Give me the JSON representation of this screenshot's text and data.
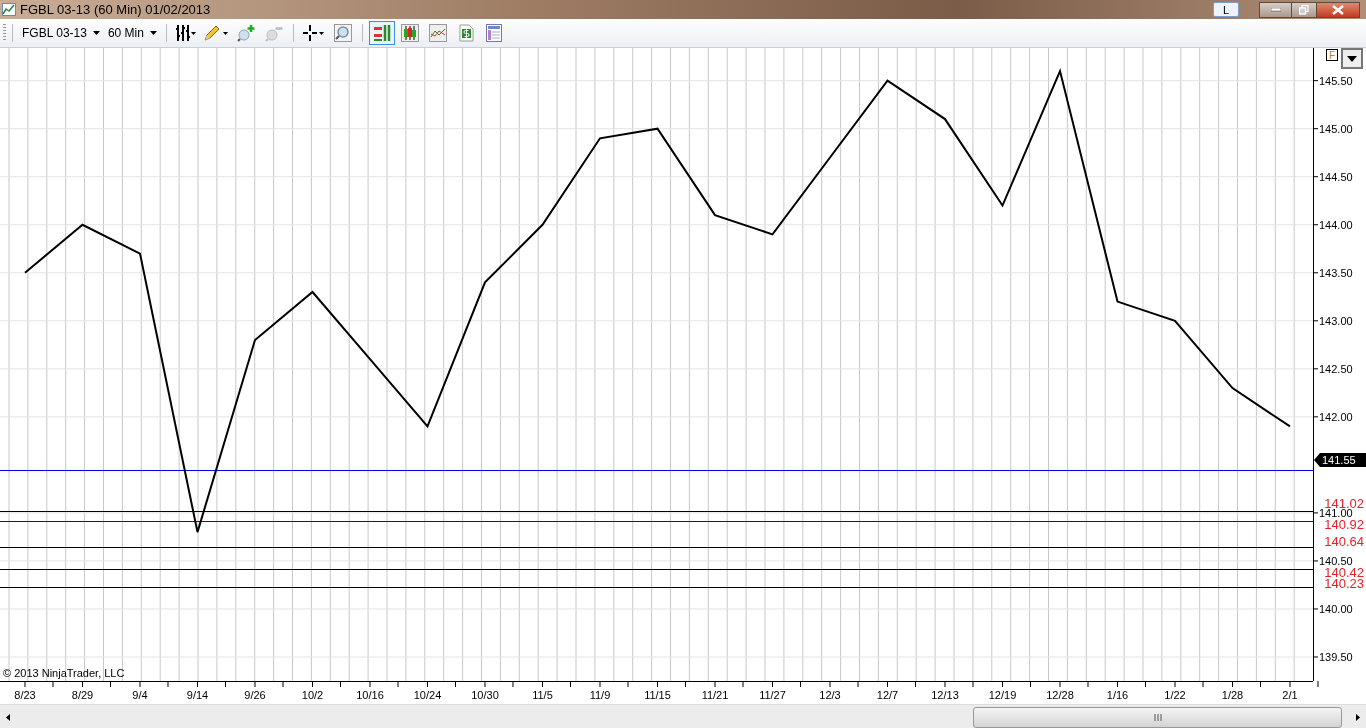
{
  "window": {
    "title": "FGBL 03-13 (60 Min)  01/02/2013",
    "link_button": "L"
  },
  "toolbar": {
    "instrument": "FGBL 03-13",
    "interval": "60 Min",
    "tools": [
      {
        "kind": "bar-type",
        "selected": false
      },
      {
        "kind": "pencil",
        "selected": false
      },
      {
        "kind": "zoom-in",
        "selected": false
      },
      {
        "kind": "zoom-out",
        "selected": false
      },
      {
        "kind": "crosshair",
        "selected": false
      },
      {
        "kind": "magnifier",
        "selected": false
      },
      {
        "kind": "data-box",
        "selected": true
      },
      {
        "kind": "candles",
        "selected": false
      },
      {
        "kind": "indicators",
        "selected": false
      },
      {
        "kind": "dollar",
        "selected": false
      },
      {
        "kind": "properties",
        "selected": false
      }
    ]
  },
  "chart": {
    "float_button": "F",
    "copyright": "© 2013 NinjaTrader, LLC",
    "last_price": "141.55",
    "chart_data": {
      "type": "line",
      "categories": [
        "8/23",
        "8/29",
        "9/4",
        "9/14",
        "9/26",
        "10/2",
        "10/16",
        "10/24",
        "10/30",
        "11/5",
        "11/9",
        "11/15",
        "11/21",
        "11/27",
        "12/3",
        "12/7",
        "12/13",
        "12/19",
        "12/28",
        "1/16",
        "1/22",
        "1/28",
        "2/1"
      ],
      "grid": true,
      "series": [
        {
          "color": "#000000",
          "values": [
            143.5,
            144.0,
            143.7,
            140.8,
            142.8,
            143.3,
            142.6,
            141.9,
            143.4,
            144.0,
            144.9,
            145.0,
            144.1,
            143.9,
            144.7,
            145.5,
            145.1,
            144.2,
            145.6,
            143.2,
            143.0,
            142.3,
            141.9
          ]
        }
      ],
      "ylim": [
        139.25,
        145.84
      ],
      "yticks": [
        {
          "value": 139.5,
          "label": "139.50"
        },
        {
          "value": 140,
          "label": "140.00"
        },
        {
          "value": 140.5,
          "label": "140.50"
        },
        {
          "value": 141,
          "label": "141.00"
        },
        {
          "value": 142,
          "label": "142.00"
        },
        {
          "value": 142.5,
          "label": "142.50"
        },
        {
          "value": 143,
          "label": "143.00"
        },
        {
          "value": 143.5,
          "label": "143.50"
        },
        {
          "value": 144,
          "label": "144.00"
        },
        {
          "value": 144.5,
          "label": "144.50"
        },
        {
          "value": 145,
          "label": "145.00"
        },
        {
          "value": 145.5,
          "label": "145.50"
        }
      ],
      "ref_lines": [
        {
          "axis": "y",
          "value": 141.45,
          "color": "#0000ff"
        },
        {
          "axis": "y",
          "value": 141.02,
          "label": "141.02",
          "color": "#000000"
        },
        {
          "axis": "y",
          "value": 140.92,
          "label": "140.92",
          "color": "#0000ff"
        },
        {
          "axis": "y",
          "value": 140.64,
          "label": "140.64",
          "color": "#000000"
        },
        {
          "axis": "y",
          "value": 140.42,
          "label": "140.42",
          "color": "#000000"
        },
        {
          "axis": "y",
          "value": 140.23,
          "label": "140.23",
          "color": "#000000"
        }
      ]
    }
  }
}
